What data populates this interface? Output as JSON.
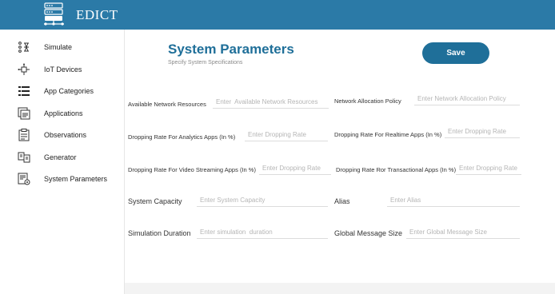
{
  "app": {
    "title": "EDICT"
  },
  "sidebar": {
    "items": [
      {
        "label": "Simulate",
        "icon": "simulate-icon"
      },
      {
        "label": "IoT Devices",
        "icon": "iot-devices-icon"
      },
      {
        "label": "App Categories",
        "icon": "list-icon"
      },
      {
        "label": "Applications",
        "icon": "applications-icon"
      },
      {
        "label": "Observations",
        "icon": "clipboard-icon"
      },
      {
        "label": "Generator",
        "icon": "generator-icon"
      },
      {
        "label": "System Parameters",
        "icon": "settings-doc-icon"
      }
    ]
  },
  "page": {
    "title": "System Parameters",
    "subtitle": "Specify System Specifications",
    "save_label": "Save"
  },
  "fields": {
    "available_network_resources": {
      "label": "Available Network Resources",
      "placeholder": "Enter  Available Network Resources"
    },
    "network_allocation_policy": {
      "label": "Network Allocation Policy",
      "placeholder": "Enter Network Allocation Policy"
    },
    "dropping_rate_analytics": {
      "label": "Dropping Rate For Analytics Apps (In %)",
      "placeholder": "Enter Dropping Rate"
    },
    "dropping_rate_realtime": {
      "label": "Dropping Rate For Realtime Apps (In %)",
      "placeholder": "Enter Dropping Rate"
    },
    "dropping_rate_video": {
      "label": "Dropping Rate For Video Streaming Apps (In %)",
      "placeholder": "Enter Dropping Rate"
    },
    "dropping_rate_transactional": {
      "label": "Dropping Rate Ror Transactional Apps (In %)",
      "placeholder": "Enter Dropping Rate"
    },
    "system_capacity": {
      "label": "System Capacity",
      "placeholder": "Enter System Capacity"
    },
    "alias": {
      "label": "Alias",
      "placeholder": "Enter Alias"
    },
    "simulation_duration": {
      "label": "Simulation Duration",
      "placeholder": "Enter simulation  duration"
    },
    "global_message_size": {
      "label": "Global Message Size",
      "placeholder": "Enter Global Message Size"
    }
  },
  "colors": {
    "topbar": "#2b7aa7",
    "accent": "#1f6f99"
  }
}
